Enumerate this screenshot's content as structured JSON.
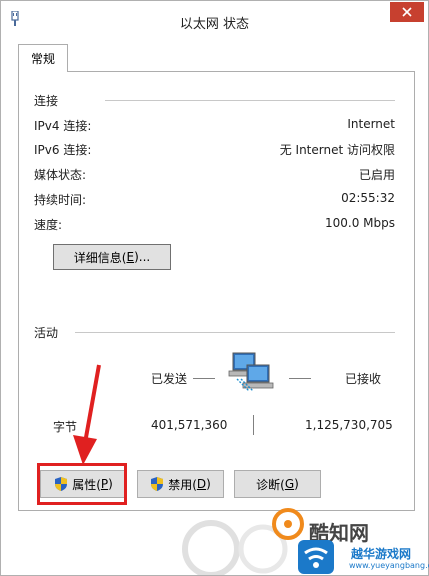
{
  "window": {
    "title": "以太网 状态",
    "close_label": "✕"
  },
  "tabs": [
    {
      "label": "常规"
    }
  ],
  "connection": {
    "section_title": "连接",
    "rows": [
      {
        "label": "IPv4 连接:",
        "value": "Internet"
      },
      {
        "label": "IPv6 连接:",
        "value": "无 Internet 访问权限"
      },
      {
        "label": "媒体状态:",
        "value": "已启用"
      },
      {
        "label": "持续时间:",
        "value": "02:55:32"
      },
      {
        "label": "速度:",
        "value": "100.0 Mbps"
      }
    ],
    "details_button": {
      "label": "详细信息(",
      "mnemonic": "E",
      "suffix": ")..."
    }
  },
  "activity": {
    "section_title": "活动",
    "sent_label": "已发送",
    "received_label": "已接收",
    "bytes_label": "字节",
    "bytes_sent": "401,571,360",
    "bytes_received": "1,125,730,705"
  },
  "buttons": {
    "properties": {
      "label": "属性(",
      "mnemonic": "P",
      "suffix": ")"
    },
    "disable": {
      "label": "禁用(",
      "mnemonic": "D",
      "suffix": ")"
    },
    "diagnose": {
      "label": "诊断(",
      "mnemonic": "G",
      "suffix": ")"
    }
  },
  "watermark": {
    "brand": "酷知网",
    "site_name": "越华游戏网",
    "site_url": "www.yueyangbang.com"
  },
  "colors": {
    "close_button": "#c7402f",
    "highlight": "#e02020",
    "watermark_blue": "#1b79c9"
  },
  "icons": [
    "network-adapter-icon",
    "close-icon",
    "network-computers-icon",
    "uac-shield-icon",
    "red-arrow-annotation"
  ]
}
